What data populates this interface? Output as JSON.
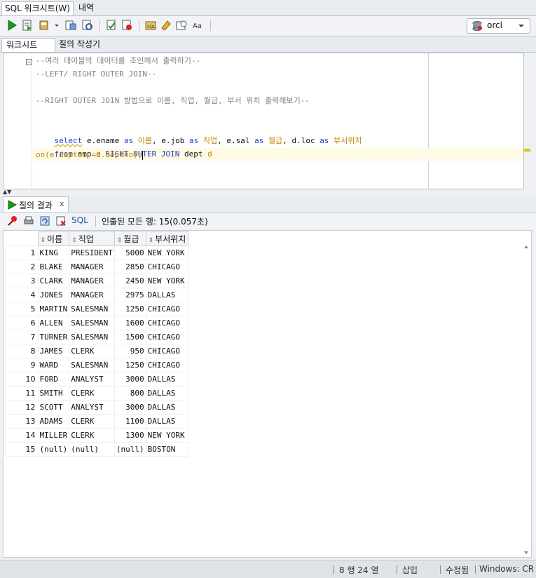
{
  "tabs": {
    "worksheet": "SQL 워크시트(W)",
    "history": "내역"
  },
  "toolbar": {
    "icons": [
      "run-statement-icon",
      "run-script-icon",
      "commit-icon",
      "dropdown-arrow-icon",
      "autotrace-icon",
      "explain-plan-icon",
      "commit-tx-icon",
      "rollback-icon",
      "unshared-sql-icon",
      "eraser-icon",
      "history-icon",
      "format-case-icon"
    ],
    "connection": "orcl"
  },
  "subtabs": {
    "worksheet": "워크시트",
    "query_builder": "질의 작성기"
  },
  "editor": {
    "lines": {
      "l1": "--여러 테이블의 데이터를 조인해서 출력하기--",
      "l2": "--LEFT/ RIGHT OUTER JOIN--",
      "l4": "--RIGHT OUTER JOIN 방법으로 이름, 직업, 월급, 부서 위치 출력해보기--",
      "l6_kw1": "select",
      "l6_t1": " e.ename ",
      "l6_kw2": "as",
      "l6_a1": " 이름",
      "l6_t2": ", e.job ",
      "l6_kw3": "as",
      "l6_a2": " 직업",
      "l6_t3": ", e.sal ",
      "l6_kw4": "as",
      "l6_a3": " 월급",
      "l6_t4": ", d.loc ",
      "l6_kw5": "as",
      "l6_a4": " 부서위치",
      "l7_kw1": "from",
      "l7_t1": " emp ",
      "l7_al1": "e",
      "l7_kw2": " RIGHT OUTER JOIN",
      "l7_t2": " dept ",
      "l7_al2": "d",
      "l8": "on(e.deptno =d.deptno);"
    }
  },
  "results": {
    "tab_label": "질의 결과",
    "close": "x",
    "sql_label": "SQL",
    "status": "인출된 모든 행: 15(0.057초)",
    "columns": [
      "이름",
      "직업",
      "월급",
      "부서위치"
    ],
    "rows": [
      [
        "1",
        "KING",
        "PRESIDENT",
        "5000",
        "NEW YORK"
      ],
      [
        "2",
        "BLAKE",
        "MANAGER",
        "2850",
        "CHICAGO"
      ],
      [
        "3",
        "CLARK",
        "MANAGER",
        "2450",
        "NEW YORK"
      ],
      [
        "4",
        "JONES",
        "MANAGER",
        "2975",
        "DALLAS"
      ],
      [
        "5",
        "MARTIN",
        "SALESMAN",
        "1250",
        "CHICAGO"
      ],
      [
        "6",
        "ALLEN",
        "SALESMAN",
        "1600",
        "CHICAGO"
      ],
      [
        "7",
        "TURNER",
        "SALESMAN",
        "1500",
        "CHICAGO"
      ],
      [
        "8",
        "JAMES",
        "CLERK",
        "950",
        "CHICAGO"
      ],
      [
        "9",
        "WARD",
        "SALESMAN",
        "1250",
        "CHICAGO"
      ],
      [
        "10",
        "FORD",
        "ANALYST",
        "3000",
        "DALLAS"
      ],
      [
        "11",
        "SMITH",
        "CLERK",
        "800",
        "DALLAS"
      ],
      [
        "12",
        "SCOTT",
        "ANALYST",
        "3000",
        "DALLAS"
      ],
      [
        "13",
        "ADAMS",
        "CLERK",
        "1100",
        "DALLAS"
      ],
      [
        "14",
        "MILLER",
        "CLERK",
        "1300",
        "NEW YORK"
      ],
      [
        "15",
        "(null)",
        "(null)",
        "(null)",
        "BOSTON"
      ]
    ]
  },
  "statusbar": {
    "position": "8 행 24 열",
    "mode": "삽입",
    "state": "수정됨",
    "line_end": "Windows: CR"
  },
  "colors": {
    "keyword": "#1e3fbf",
    "alias": "#c48400",
    "comment": "#7f7f7f",
    "run_green": "#1a9a1a"
  }
}
